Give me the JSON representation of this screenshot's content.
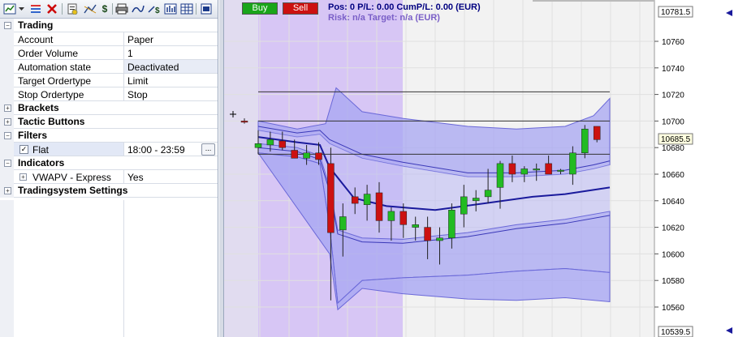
{
  "toolbar": {
    "icons": [
      "chart-settings-icon",
      "dropdown-arrow-icon",
      "list-icon",
      "close-x-icon",
      "document-icon",
      "trend-line-icon",
      "dollar-icon",
      "printer-icon",
      "line-draw-icon",
      "dollar-line-icon",
      "bar-chart-icon",
      "table-icon",
      "export-icon"
    ]
  },
  "properties": {
    "trading": {
      "title": "Trading"
    },
    "account": {
      "label": "Account",
      "value": "Paper"
    },
    "order_volume": {
      "label": "Order Volume",
      "value": "1"
    },
    "automation_state": {
      "label": "Automation state",
      "value": "Deactivated"
    },
    "target_ordertype": {
      "label": "Target Ordertype",
      "value": "Limit"
    },
    "stop_ordertype": {
      "label": "Stop Ordertype",
      "value": "Stop"
    },
    "brackets": {
      "title": "Brackets"
    },
    "tactic_buttons": {
      "title": "Tactic Buttons"
    },
    "filters": {
      "title": "Filters"
    },
    "flat": {
      "label": "Flat",
      "value": "18:00 - 23:59",
      "checked": "✓",
      "ellipsis": "..."
    },
    "indicators": {
      "title": "Indicators"
    },
    "vwapv": {
      "label": "VWAPV - Express",
      "value": "Yes"
    },
    "tradingsystem_settings": {
      "title": "Tradingsystem Settings"
    }
  },
  "trade_bar": {
    "buy_label": "Buy",
    "sell_label": "Sell",
    "position_text": "Pos: 0  P/L: 0.00  CumP/L: 0.00 (EUR)",
    "risk_text": "Risk: n/a  Target: n/a (EUR)"
  },
  "colors": {
    "buy": "#1aa51a",
    "sell": "#cc1111",
    "band_fill": "#a7a6f2",
    "vwap_line": "#1a1a9c",
    "session_shade": "#d9c9f5",
    "bull_candle": "#22bb22",
    "bear_candle": "#cc1111"
  },
  "chart_data": {
    "type": "candlestick",
    "y_axis": {
      "ticks": [
        10760,
        10740,
        10720,
        10700,
        10680,
        10660,
        10640,
        10620,
        10600,
        10580,
        10560
      ],
      "top_label": "10781.5",
      "bottom_label": "10539.5",
      "current_price_label": "10685.5",
      "range": [
        10539.5,
        10781.5
      ]
    },
    "candles": [
      {
        "o": 10700,
        "h": 10702,
        "l": 10698,
        "c": 10700,
        "color": "bear"
      },
      {
        "o": 10680,
        "h": 10693,
        "l": 10675,
        "c": 10683,
        "color": "bull"
      },
      {
        "o": 10682,
        "h": 10692,
        "l": 10677,
        "c": 10686,
        "color": "bull"
      },
      {
        "o": 10685,
        "h": 10692,
        "l": 10678,
        "c": 10680,
        "color": "bear"
      },
      {
        "o": 10678,
        "h": 10686,
        "l": 10672,
        "c": 10672,
        "color": "bear"
      },
      {
        "o": 10672,
        "h": 10682,
        "l": 10667,
        "c": 10676,
        "color": "bull"
      },
      {
        "o": 10676,
        "h": 10684,
        "l": 10667,
        "c": 10671,
        "color": "bear"
      },
      {
        "o": 10668,
        "h": 10680,
        "l": 10565,
        "c": 10616,
        "color": "bear"
      },
      {
        "o": 10618,
        "h": 10638,
        "l": 10598,
        "c": 10628,
        "color": "bull"
      },
      {
        "o": 10643,
        "h": 10650,
        "l": 10630,
        "c": 10638,
        "color": "bear"
      },
      {
        "o": 10637,
        "h": 10652,
        "l": 10625,
        "c": 10645,
        "color": "bull"
      },
      {
        "o": 10646,
        "h": 10654,
        "l": 10616,
        "c": 10625,
        "color": "bear"
      },
      {
        "o": 10625,
        "h": 10635,
        "l": 10610,
        "c": 10632,
        "color": "bull"
      },
      {
        "o": 10632,
        "h": 10638,
        "l": 10612,
        "c": 10622,
        "color": "bear"
      },
      {
        "o": 10620,
        "h": 10628,
        "l": 10610,
        "c": 10622,
        "color": "bull"
      },
      {
        "o": 10620,
        "h": 10628,
        "l": 10596,
        "c": 10610,
        "color": "bear"
      },
      {
        "o": 10610,
        "h": 10620,
        "l": 10592,
        "c": 10612,
        "color": "bull"
      },
      {
        "o": 10612,
        "h": 10638,
        "l": 10604,
        "c": 10633,
        "color": "bull"
      },
      {
        "o": 10630,
        "h": 10652,
        "l": 10620,
        "c": 10643,
        "color": "bull"
      },
      {
        "o": 10640,
        "h": 10648,
        "l": 10632,
        "c": 10642,
        "color": "bull"
      },
      {
        "o": 10643,
        "h": 10664,
        "l": 10638,
        "c": 10648,
        "color": "bull"
      },
      {
        "o": 10650,
        "h": 10670,
        "l": 10634,
        "c": 10668,
        "color": "bull"
      },
      {
        "o": 10668,
        "h": 10674,
        "l": 10654,
        "c": 10660,
        "color": "bear"
      },
      {
        "o": 10660,
        "h": 10666,
        "l": 10654,
        "c": 10664,
        "color": "bull"
      },
      {
        "o": 10664,
        "h": 10668,
        "l": 10655,
        "c": 10664,
        "color": "bull"
      },
      {
        "o": 10668,
        "h": 10674,
        "l": 10660,
        "c": 10660,
        "color": "bear"
      },
      {
        "o": 10663,
        "h": 10664,
        "l": 10660,
        "c": 10663,
        "color": "bull"
      },
      {
        "o": 10660,
        "h": 10681,
        "l": 10652,
        "c": 10676,
        "color": "bull"
      },
      {
        "o": 10676,
        "h": 10697,
        "l": 10672,
        "c": 10694,
        "color": "bull"
      },
      {
        "o": 10696,
        "h": 10696,
        "l": 10684,
        "c": 10686,
        "color": "bear"
      }
    ]
  }
}
